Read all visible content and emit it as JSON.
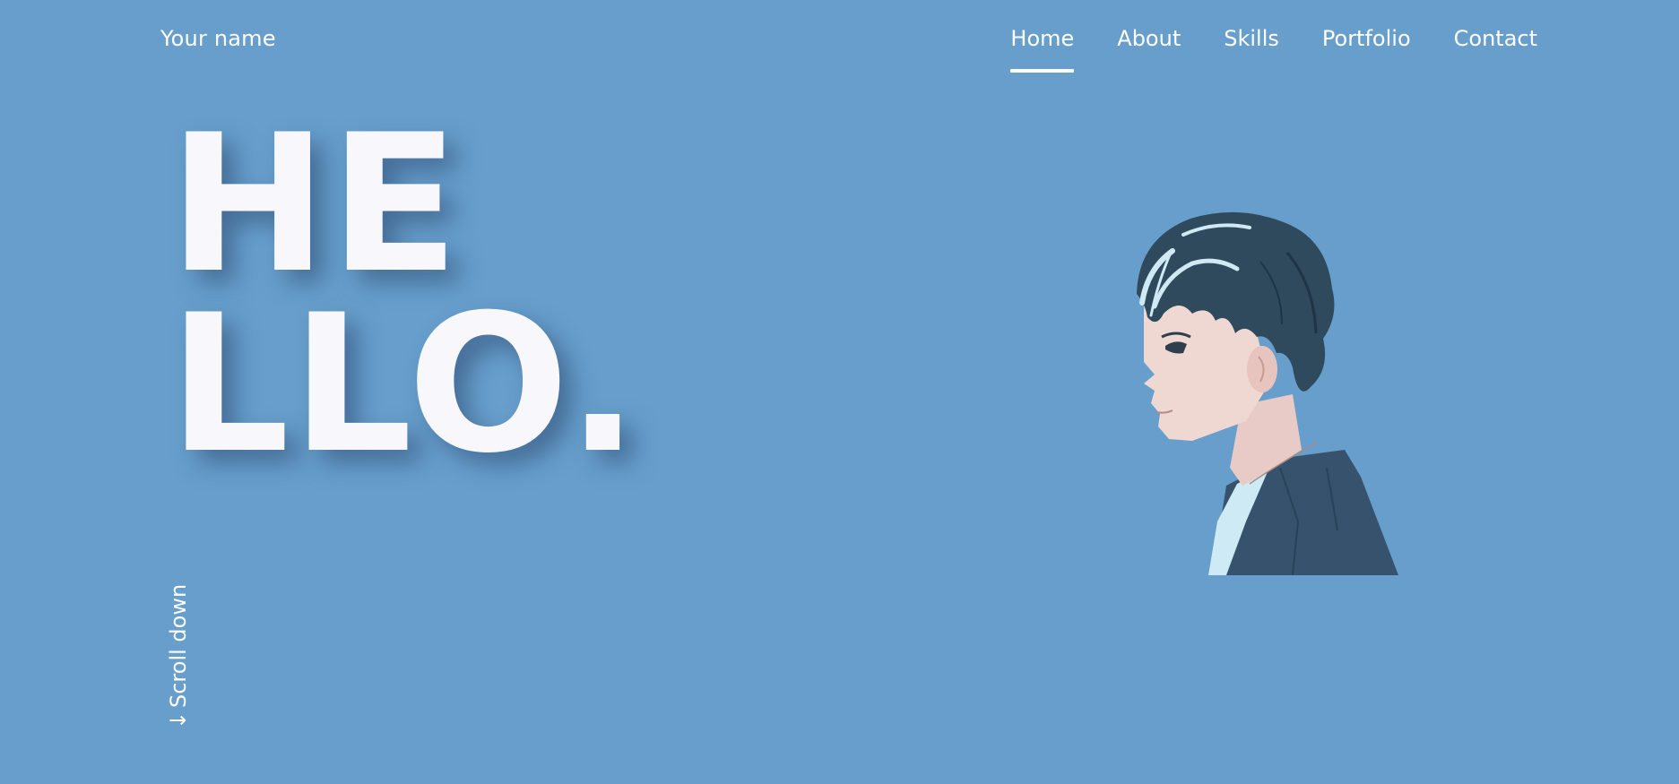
{
  "header": {
    "brand": "Your name",
    "nav": [
      {
        "label": "Home",
        "active": true
      },
      {
        "label": "About",
        "active": false
      },
      {
        "label": "Skills",
        "active": false
      },
      {
        "label": "Portfolio",
        "active": false
      },
      {
        "label": "Contact",
        "active": false
      }
    ]
  },
  "hero": {
    "title_line1": "HE",
    "title_line2": "LLO."
  },
  "scroll": {
    "arrow": "↓",
    "label": "Scroll down"
  },
  "illustration": {
    "icon": "portrait-illustration"
  },
  "colors": {
    "background": "#679ecb",
    "text": "#ffffff",
    "hair": "#2e4a5c",
    "hair_highlight": "#cfeaf5",
    "skin": "#efd7d2",
    "jacket": "#36526d",
    "shirt": "#cdeaf5"
  }
}
